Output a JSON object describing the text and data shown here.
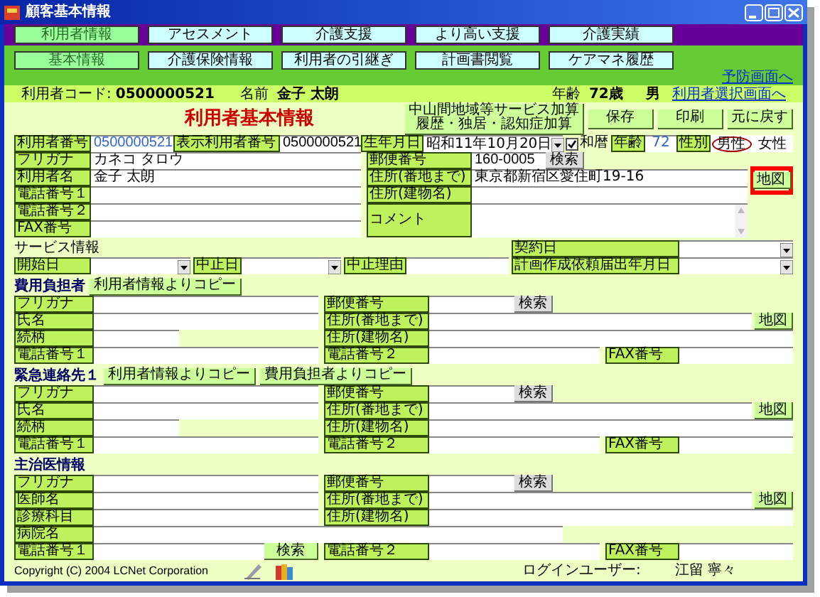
{
  "window": {
    "title": "顧客基本情報"
  },
  "main_tabs": [
    {
      "label": "利用者情報",
      "selected": true
    },
    {
      "label": "アセスメント",
      "selected": false
    },
    {
      "label": "介護支援",
      "selected": false
    },
    {
      "label": "より高い支援",
      "selected": false
    },
    {
      "label": "介護実績",
      "selected": false
    }
  ],
  "sub_tabs": [
    {
      "label": "基本情報",
      "selected": true
    },
    {
      "label": "介護保険情報",
      "selected": false
    },
    {
      "label": "利用者の引継ぎ",
      "selected": false
    },
    {
      "label": "計画書閲覧",
      "selected": false
    },
    {
      "label": "ケアマネ履歴",
      "selected": false
    }
  ],
  "preventive_link": "予防画面へ",
  "summary": {
    "code_label": "利用者コード:",
    "code": "0500000521",
    "name_label": "名前",
    "name": "金子 太朗",
    "age_label": "年齢",
    "age": "72歳",
    "sex": "男",
    "select_link": "利用者選択画面へ"
  },
  "basic": {
    "title": "利用者基本情報",
    "buttons": [
      "中山間地域等サービス加算履歴・独居・認知症加算",
      "保存",
      "印刷",
      "元に戻す"
    ],
    "user_no_label": "利用者番号",
    "user_no": "0500000521",
    "display_no_label": "表示利用者番号",
    "display_no": "0500000521",
    "birth_label": "生年月日",
    "birth": "昭和11年10月20日",
    "wareki_label": "和暦",
    "wareki_checked": true,
    "age_label": "年齢",
    "age": "72",
    "sex_label": "性別",
    "sex_options": [
      {
        "label": "男性",
        "selected": true
      },
      {
        "label": "女性",
        "selected": false
      }
    ],
    "furigana_label": "フリガナ",
    "furigana": "カネコ タロウ",
    "name_label": "利用者名",
    "name": "金子 太朗",
    "tel1_label": "電話番号１",
    "tel2_label": "電話番号２",
    "fax_label": "FAX番号",
    "postal_label": "郵便番号",
    "postal": "160-0005",
    "search": "検索",
    "address_label": "住所(番地まで)",
    "address": "東京都新宿区愛住町19-16",
    "map": "地図",
    "map_highlighted": true,
    "building_label": "住所(建物名)",
    "comment_label": "コメント"
  },
  "service": {
    "title": "サービス情報",
    "contract_label": "契約日",
    "start_label": "開始日",
    "stop_label": "中止日",
    "reason_label": "中止理由",
    "plan_label": "計画作成依頼届出年月日"
  },
  "sections": [
    {
      "title": "費用負担者",
      "copy_buttons": [
        "利用者情報よりコピー"
      ],
      "rows": [
        {
          "kind": "postal",
          "left": "フリガナ",
          "right": "郵便番号",
          "button": "検索"
        },
        {
          "kind": "address",
          "left": "氏名",
          "right": "住所(番地まで)",
          "button": "地図"
        },
        {
          "kind": "building",
          "left": "続柄",
          "right": "住所(建物名)"
        },
        {
          "kind": "phone",
          "left": "電話番号１",
          "right": "電話番号２",
          "fax": "FAX番号"
        }
      ]
    },
    {
      "title": "緊急連絡先１",
      "copy_buttons": [
        "利用者情報よりコピー",
        "費用負担者よりコピー"
      ],
      "rows": [
        {
          "kind": "postal",
          "left": "フリガナ",
          "right": "郵便番号",
          "button": "検索"
        },
        {
          "kind": "address",
          "left": "氏名",
          "right": "住所(番地まで)",
          "button": "地図"
        },
        {
          "kind": "building",
          "left": "続柄",
          "right": "住所(建物名)"
        },
        {
          "kind": "phone",
          "left": "電話番号１",
          "right": "電話番号２",
          "fax": "FAX番号"
        }
      ]
    },
    {
      "title": "主治医情報",
      "rows": [
        {
          "kind": "postal",
          "left": "フリガナ",
          "right": "郵便番号",
          "button": "検索"
        },
        {
          "kind": "address",
          "left": "医師名",
          "right": "住所(番地まで)",
          "button": "地図"
        },
        {
          "kind": "wide",
          "left": "診療科目",
          "right": "住所(建物名)"
        },
        {
          "kind": "single",
          "left": "病院名"
        },
        {
          "kind": "phone",
          "left": "電話番号１",
          "left_button": "検索",
          "right": "電話番号２",
          "fax": "FAX番号"
        }
      ]
    }
  ],
  "footer": {
    "copyright": "Copyright (C) 2004 LCNet Corporation",
    "login_label": "ログインユーザー:",
    "login_user": "江留 寧々"
  }
}
